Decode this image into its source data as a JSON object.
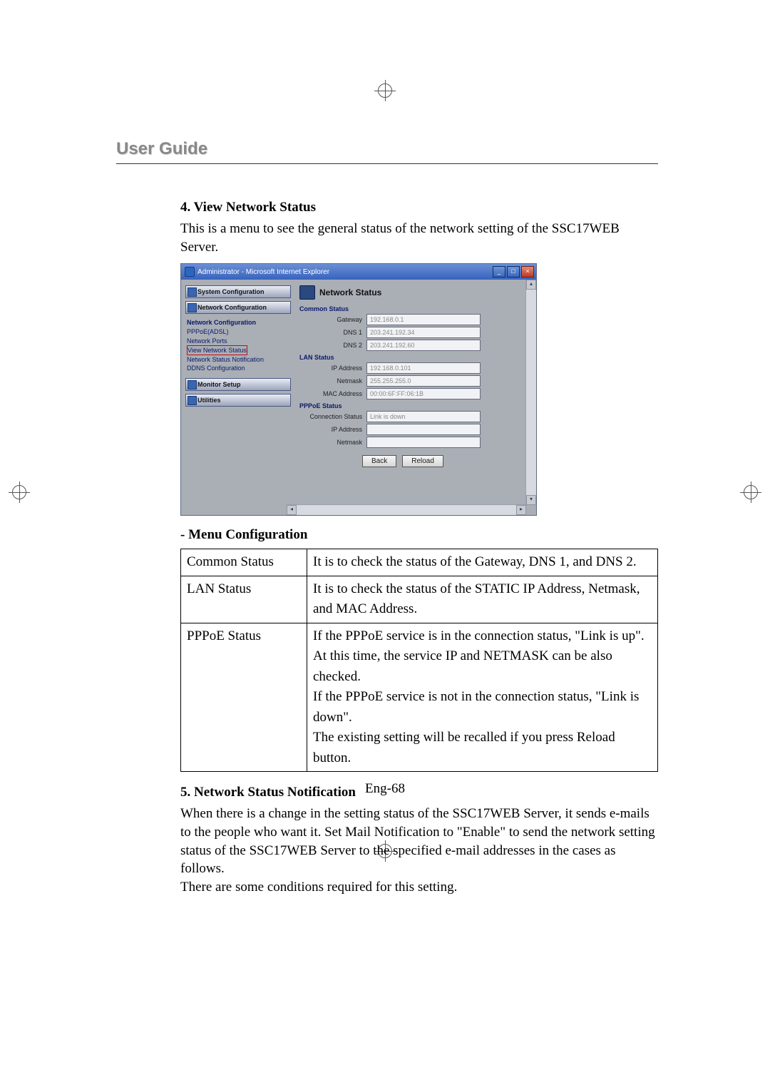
{
  "site_header": "User Guide",
  "sections": {
    "s4_title": "4. View Network Status",
    "s4_body": "This is a menu to see the general status of the network setting of the SSC17WEB Server.",
    "menu_cfg_title": "- Menu Configuration",
    "s5_title": "5. Network Status Notification",
    "s5_body": "When there is a change in the setting status of the SSC17WEB Server, it sends e-mails to the people who want it. Set Mail Notification to \"Enable\" to send the network setting status of the SSC17WEB Server to the specified e-mail addresses in the cases as follows.\nThere are some conditions required for this setting."
  },
  "screenshot": {
    "window_title": "Administrator - Microsoft Internet Explorer",
    "window_controls": {
      "min": "_",
      "max": "□",
      "close": "×"
    },
    "sidebar": {
      "buttons": {
        "system_cfg": "System Configuration",
        "network_cfg": "Network Configuration",
        "monitor_setup": "Monitor Setup",
        "utilities": "Utilities"
      },
      "subnav": {
        "header": "Network Configuration",
        "items": [
          "PPPoE(ADSL)",
          "Network Ports",
          "View Network Status",
          "Network Status Notification",
          "DDNS Configuration"
        ],
        "highlight_index": 2
      }
    },
    "main": {
      "title": "Network Status",
      "groups": {
        "common": {
          "label": "Common Status",
          "rows": [
            {
              "label": "Gateway",
              "value": "192.168.0.1"
            },
            {
              "label": "DNS 1",
              "value": "203.241.192.34"
            },
            {
              "label": "DNS 2",
              "value": "203.241.192.60"
            }
          ]
        },
        "lan": {
          "label": "LAN Status",
          "rows": [
            {
              "label": "IP Address",
              "value": "192.168.0.101"
            },
            {
              "label": "Netmask",
              "value": "255.255.255.0"
            },
            {
              "label": "MAC Address",
              "value": "00:00:6F:FF:06:1B"
            }
          ]
        },
        "pppoe": {
          "label": "PPPoE Status",
          "rows": [
            {
              "label": "Connection Status",
              "value": "Link is down"
            },
            {
              "label": "IP Address",
              "value": ""
            },
            {
              "label": "Netmask",
              "value": ""
            }
          ]
        }
      },
      "buttons": {
        "back": "Back",
        "reload": "Reload"
      }
    }
  },
  "config_table": {
    "rows": [
      {
        "key": "Common Status",
        "val": "It is to check the status of the Gateway, DNS 1, and DNS 2."
      },
      {
        "key": "LAN Status",
        "val": "It is to check the status of the STATIC IP Address, Netmask, and MAC Address."
      },
      {
        "key": "PPPoE Status",
        "val": "If the PPPoE service is in the connection status, \"Link is up\".\nAt this time, the service IP and NETMASK can be also checked.\nIf the PPPoE service is not in the connection status, \"Link is down\".\nThe existing setting will be recalled if you press Reload button."
      }
    ]
  },
  "page_number": "Eng-68"
}
